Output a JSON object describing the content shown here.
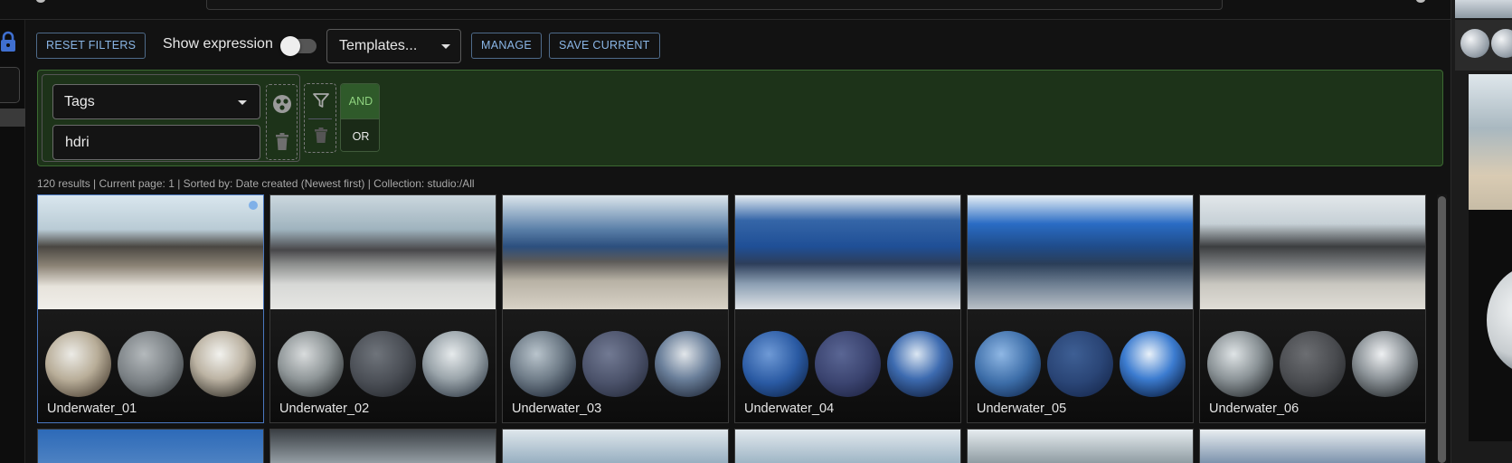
{
  "toolbar": {
    "reset_filters": "RESET FILTERS",
    "show_expression": "Show expression",
    "show_expression_on": false,
    "templates": "Templates...",
    "manage": "MANAGE",
    "save_current": "SAVE CURRENT"
  },
  "filter": {
    "field": "Tags",
    "value": "hdri",
    "logic": {
      "and": "AND",
      "or": "OR",
      "selected": "AND"
    }
  },
  "status": "120 results | Current page: 1 | Sorted by: Date created (Newest first) | Collection: studio:/All",
  "assets": [
    {
      "name": "Underwater_01",
      "selected": true
    },
    {
      "name": "Underwater_02",
      "selected": false
    },
    {
      "name": "Underwater_03",
      "selected": false
    },
    {
      "name": "Underwater_04",
      "selected": false
    },
    {
      "name": "Underwater_05",
      "selected": false
    },
    {
      "name": "Underwater_06",
      "selected": false
    }
  ],
  "colors": {
    "accent": "#8ab6e6",
    "filter_panel_bg": "#1d3319",
    "selection": "#4a78c0"
  },
  "icons": [
    "lock-icon",
    "dropdown-caret-icon",
    "rule-options-icon",
    "trash-icon",
    "filter-funnel-icon",
    "selected-dot-icon"
  ]
}
